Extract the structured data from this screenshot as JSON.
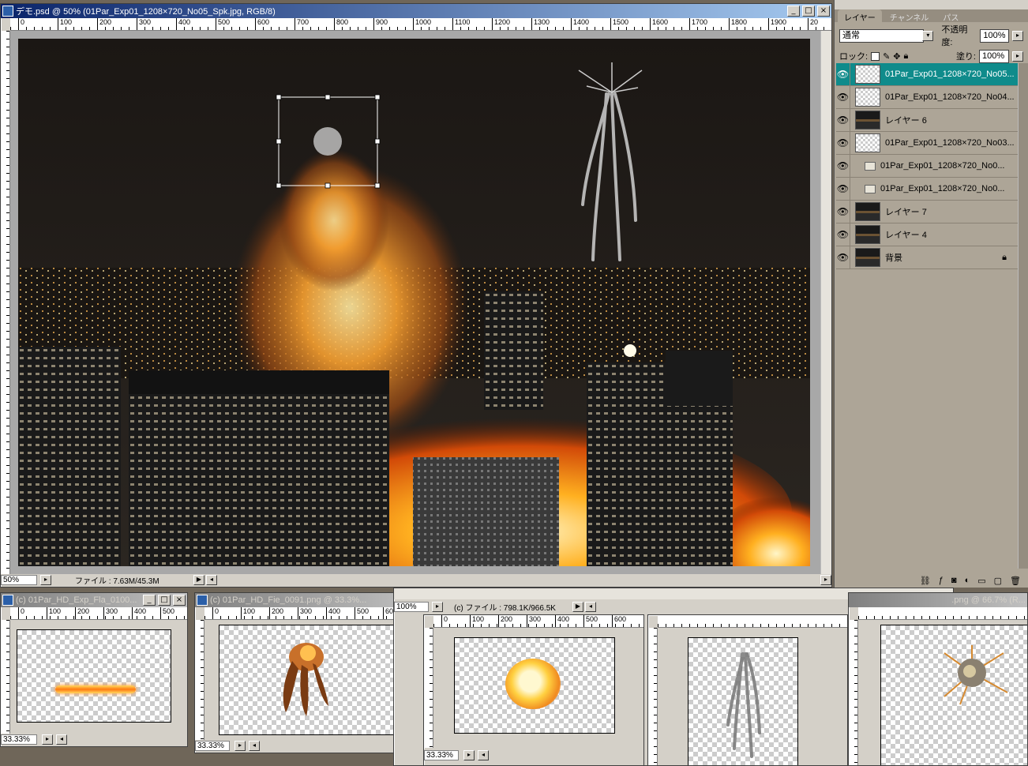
{
  "main_window": {
    "title": "デモ.psd @ 50% (01Par_Exp01_1208×720_No05_Spk.jpg, RGB/8)",
    "ruler_ticks": [
      "0",
      "100",
      "200",
      "300",
      "400",
      "500",
      "600",
      "700",
      "800",
      "900",
      "1000",
      "1100",
      "1200",
      "1300",
      "1400",
      "1500",
      "1600",
      "1700",
      "1800",
      "1900",
      "20"
    ],
    "zoom": "50%",
    "file_info": "ファイル : 7.63M/45.3M"
  },
  "layers_panel": {
    "tabs": [
      "レイヤー",
      "チャンネル",
      "パス"
    ],
    "blend_mode": "通常",
    "opacity_label": "不透明度:",
    "opacity_value": "100%",
    "lock_label": "ロック:",
    "fill_label": "塗り:",
    "fill_value": "100%",
    "layers": [
      {
        "name": "01Par_Exp01_1208×720_No05...",
        "selected": true,
        "thumb": "checker"
      },
      {
        "name": "01Par_Exp01_1208×720_No04...",
        "selected": false,
        "thumb": "checker"
      },
      {
        "name": "レイヤー 6",
        "selected": false,
        "thumb": "city"
      },
      {
        "name": "01Par_Exp01_1208×720_No03...",
        "selected": false,
        "thumb": "checker"
      },
      {
        "name": "01Par_Exp01_1208×720_No0...",
        "selected": false,
        "thumb": "folder"
      },
      {
        "name": "01Par_Exp01_1208×720_No0...",
        "selected": false,
        "thumb": "folder"
      },
      {
        "name": "レイヤー 7",
        "selected": false,
        "thumb": "city"
      },
      {
        "name": "レイヤー 4",
        "selected": false,
        "thumb": "city"
      },
      {
        "name": "背景",
        "selected": false,
        "thumb": "city",
        "locked": true
      }
    ]
  },
  "sub_windows": [
    {
      "title": "(c) 01Par_HD_Exp_Fla_0100...",
      "zoom": "33.33%"
    },
    {
      "title": "(c) 01Par_HD_Fie_0091.png @ 33.3%...",
      "zoom": "33.33%"
    },
    {
      "title": "",
      "zoom": "100%",
      "file_info": "(c) ファイル : 798.1K/966.5K"
    },
    {
      "title": "",
      "zoom": "33.33%"
    },
    {
      "title": ".png @ 66.7% (R...",
      "zoom": ""
    }
  ],
  "sub_ruler_ticks": [
    "0",
    "100",
    "200",
    "300",
    "400",
    "500",
    "600"
  ],
  "colors": {
    "selection_accent": "#0f8b8b",
    "title_active": "#0a246a",
    "panel_bg": "#ada597"
  }
}
